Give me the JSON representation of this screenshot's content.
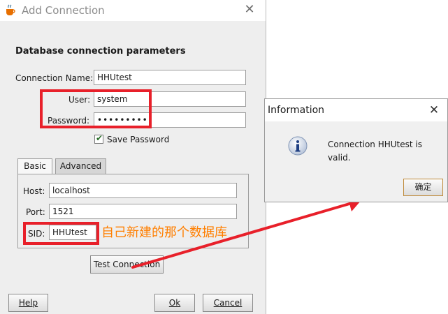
{
  "dialog": {
    "title": "Add Connection",
    "section_title": "Database connection parameters",
    "connection_name": {
      "label": "Connection Name:",
      "value": "HHUtest"
    },
    "user": {
      "label": "User:",
      "value": "system"
    },
    "password": {
      "label": "Password:",
      "value": "••••••••••"
    },
    "save_password": {
      "label": "Save Password",
      "checked": true
    },
    "tabs": [
      {
        "label": "Basic",
        "selected": true
      },
      {
        "label": "Advanced",
        "selected": false
      }
    ],
    "host": {
      "label": "Host:",
      "value": "localhost"
    },
    "port": {
      "label": "Port:",
      "value": "1521"
    },
    "sid": {
      "label": "SID:",
      "value": "HHUtest"
    },
    "buttons": {
      "test": "Test Connection",
      "help": "Help",
      "ok": "Ok",
      "cancel": "Cancel"
    }
  },
  "annotation": {
    "text": "自己新建的那个数据库",
    "color": "#ff7f00",
    "box_color": "#e8202a"
  },
  "info": {
    "title": "Information",
    "message_line1": "Connection HHUtest is",
    "message_line2": "valid.",
    "ok_label": "确定"
  }
}
